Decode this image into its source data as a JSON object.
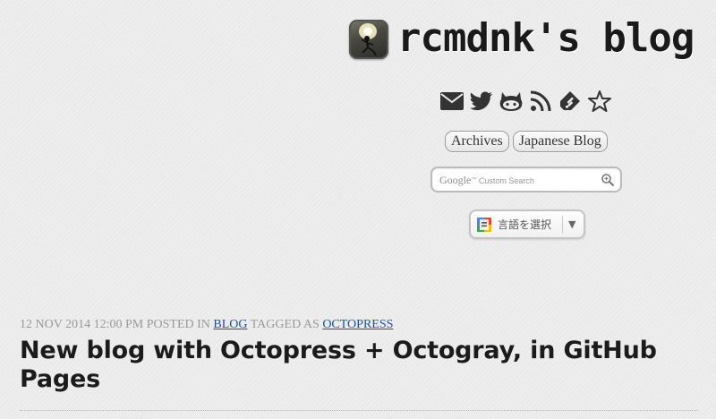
{
  "header": {
    "site_title": "rcmdnk's blog",
    "social_icons": [
      {
        "name": "mail-icon"
      },
      {
        "name": "twitter-icon"
      },
      {
        "name": "github-icon"
      },
      {
        "name": "rss-icon"
      },
      {
        "name": "feedly-icon"
      },
      {
        "name": "star-icon"
      }
    ],
    "nav": {
      "archives": "Archives",
      "japanese_blog": "Japanese Blog"
    },
    "search": {
      "google": "Google",
      "trademark": "™",
      "custom_search": "Custom Search"
    },
    "translate": {
      "label": "言語を選択",
      "arrow": "▼"
    }
  },
  "post": {
    "date": "12 Nov 2014 12:00 PM",
    "posted_in": "posted in",
    "category": "Blog",
    "tagged_as": "tagged as",
    "tag": "Octopress",
    "title": "New blog with Octopress + Octogray, in GitHub Pages"
  },
  "colors": {
    "background": "#ececec",
    "link": "#1e4fa1",
    "meta_text": "#999999",
    "title_text": "#1b1b1b"
  }
}
